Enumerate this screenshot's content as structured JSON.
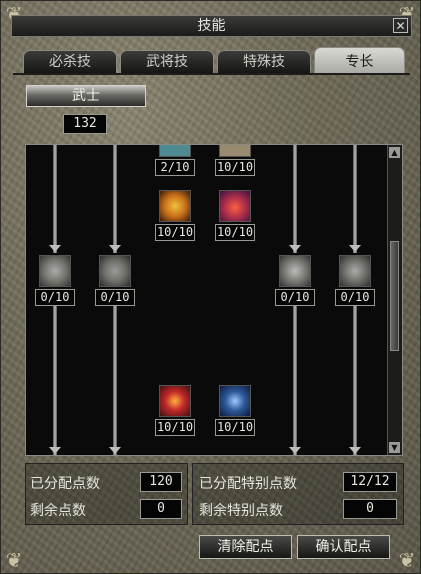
{
  "window": {
    "title": "技能",
    "close_glyph": "✕"
  },
  "tabs": [
    {
      "label": "必杀技",
      "active": false
    },
    {
      "label": "武将技",
      "active": false
    },
    {
      "label": "特殊技",
      "active": false
    },
    {
      "label": "专长",
      "active": true
    }
  ],
  "class_button": {
    "label": "武士"
  },
  "points_total": "132",
  "skill_tree": {
    "skills": [
      {
        "id": "top-a",
        "level": "2/10",
        "icon": "skill-icon-top-a",
        "color": "#4d8a92"
      },
      {
        "id": "top-b",
        "level": "10/10",
        "icon": "skill-icon-top-b",
        "color": "#9a8a70"
      },
      {
        "id": "spear-strike",
        "level": "10/10",
        "icon": "spear-strike-icon",
        "color": "#c8701a"
      },
      {
        "id": "fire-orb",
        "level": "10/10",
        "icon": "fire-orb-icon",
        "color": "#b0304a"
      },
      {
        "id": "left-1",
        "level": "0/10",
        "icon": "skill-icon-left-1",
        "color": "#777770"
      },
      {
        "id": "left-2",
        "level": "0/10",
        "icon": "skill-icon-left-2",
        "color": "#6f6f69"
      },
      {
        "id": "right-1",
        "level": "0/10",
        "icon": "skill-icon-right-1",
        "color": "#7a7a74"
      },
      {
        "id": "right-2",
        "level": "0/10",
        "icon": "skill-icon-right-2",
        "color": "#70706a"
      },
      {
        "id": "red-warrior",
        "level": "10/10",
        "icon": "red-warrior-icon",
        "color": "#c02828"
      },
      {
        "id": "blue-warrior",
        "level": "10/10",
        "icon": "blue-warrior-icon",
        "color": "#2f5a9a"
      }
    ]
  },
  "stats": {
    "allocated_label": "已分配点数",
    "allocated_value": "120",
    "remaining_label": "剩余点数",
    "remaining_value": "0",
    "special_allocated_label": "已分配特别点数",
    "special_allocated_value": "12/12",
    "special_remaining_label": "剩余特别点数",
    "special_remaining_value": "0"
  },
  "actions": {
    "clear_label": "清除配点",
    "confirm_label": "确认配点"
  }
}
